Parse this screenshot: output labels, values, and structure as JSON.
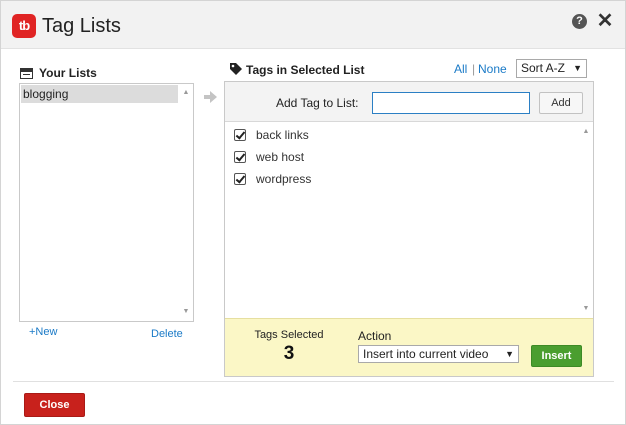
{
  "dialog": {
    "logo_text": "tb",
    "title": "Tag Lists"
  },
  "your_lists": {
    "label": "Your Lists",
    "items": [
      {
        "label": "blogging",
        "selected": true
      }
    ],
    "new_label": "+New",
    "delete_label": "Delete"
  },
  "tags_panel": {
    "label": "Tags in Selected List",
    "all_label": "All",
    "separator": "|",
    "none_label": "None",
    "sort": {
      "value": "Sort A-Z"
    },
    "add_label": "Add Tag to List:",
    "add_input": {
      "value": "",
      "placeholder": ""
    },
    "add_button_label": "Add",
    "tags": [
      {
        "label": "back links",
        "checked": true
      },
      {
        "label": "web host",
        "checked": true
      },
      {
        "label": "wordpress",
        "checked": true
      }
    ]
  },
  "footer": {
    "tags_selected_label": "Tags Selected",
    "tags_selected_count": "3",
    "action_label": "Action",
    "action_value": "Insert into current video",
    "insert_label": "Insert"
  },
  "close_label": "Close",
  "colors": {
    "brand_red": "#e02424",
    "link_blue": "#1a7ac7",
    "insert_green": "#4a9e2f",
    "footer_yellow": "#fbf7c6",
    "close_red": "#c8211c"
  }
}
